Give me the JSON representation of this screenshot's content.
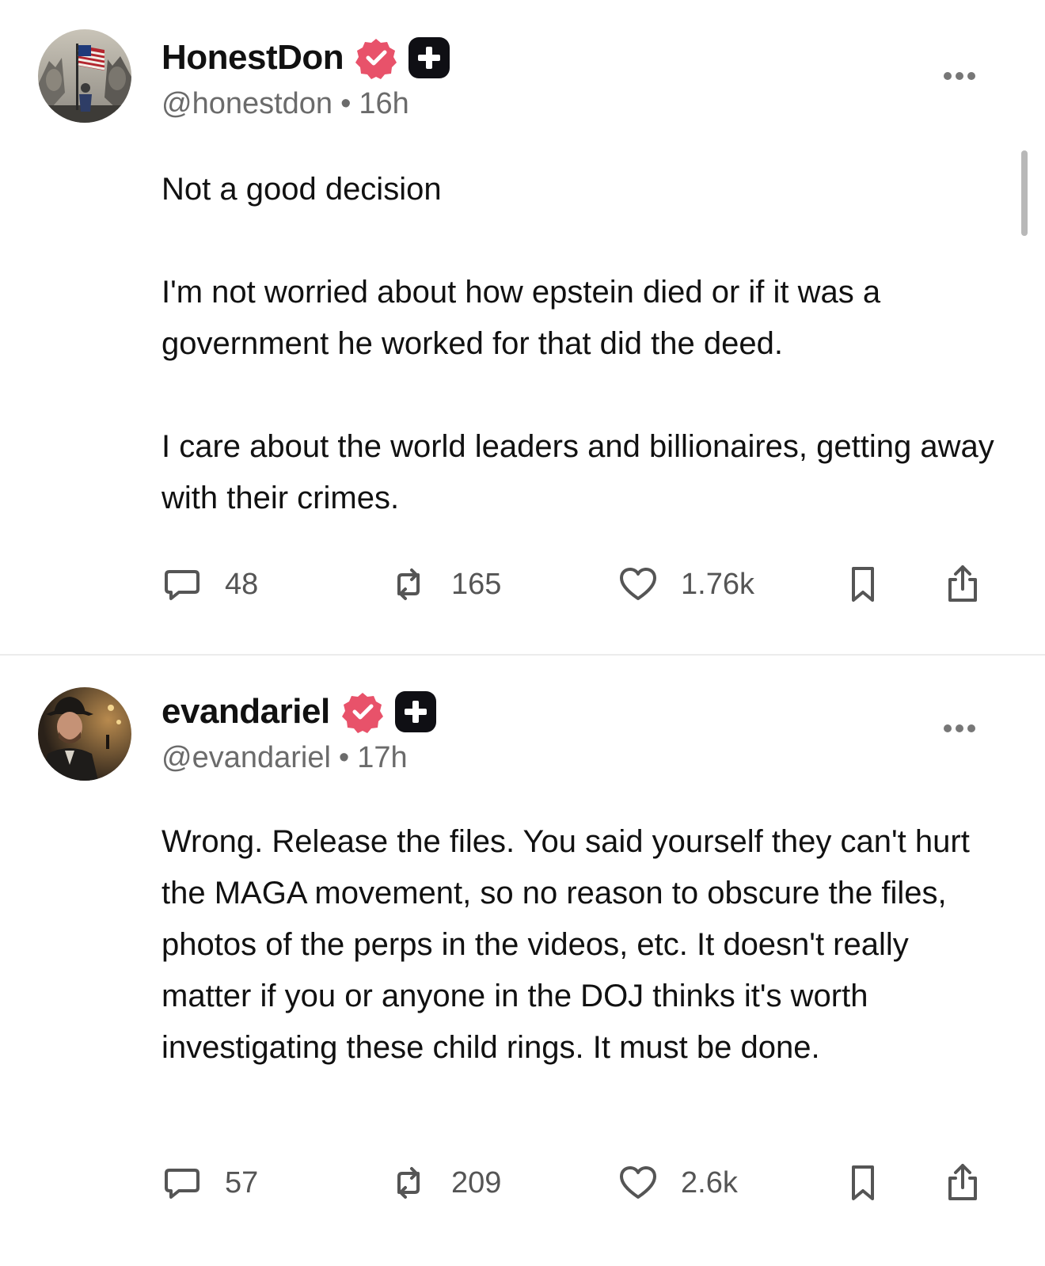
{
  "posts": [
    {
      "display_name": "HonestDon",
      "handle": "@honestdon",
      "separator": "•",
      "time": "16h",
      "avatar_icon": "avatar-flag-monument",
      "verified_icon": "verified-badge-icon",
      "plus_icon": "plus-badge-icon",
      "paragraphs": [
        "Not a good decision",
        "I'm not worried about how epstein died or if it was a government he worked for that did the deed.",
        "I care about the world leaders and billionaires, getting away with their crimes."
      ],
      "stats": {
        "replies": "48",
        "reposts": "165",
        "likes": "1.76k"
      }
    },
    {
      "display_name": "evandariel",
      "handle": "@evandariel",
      "separator": "•",
      "time": "17h",
      "avatar_icon": "avatar-man-in-hat",
      "verified_icon": "verified-badge-icon",
      "plus_icon": "plus-badge-icon",
      "paragraphs": [
        "Wrong. Release the files. You said yourself they can't hurt the MAGA movement, so no reason to obscure the files, photos of the perps in the videos, etc. It doesn't really matter if you or anyone in the DOJ thinks it's worth investigating these child rings. It must be done."
      ],
      "stats": {
        "replies": "57",
        "reposts": "209",
        "likes": "2.6k"
      }
    }
  ],
  "colors": {
    "verified": "#e8526a",
    "plus_badge": "#0f0f14",
    "text": "#111111",
    "meta": "#6b6b6b",
    "icon": "#555555"
  }
}
